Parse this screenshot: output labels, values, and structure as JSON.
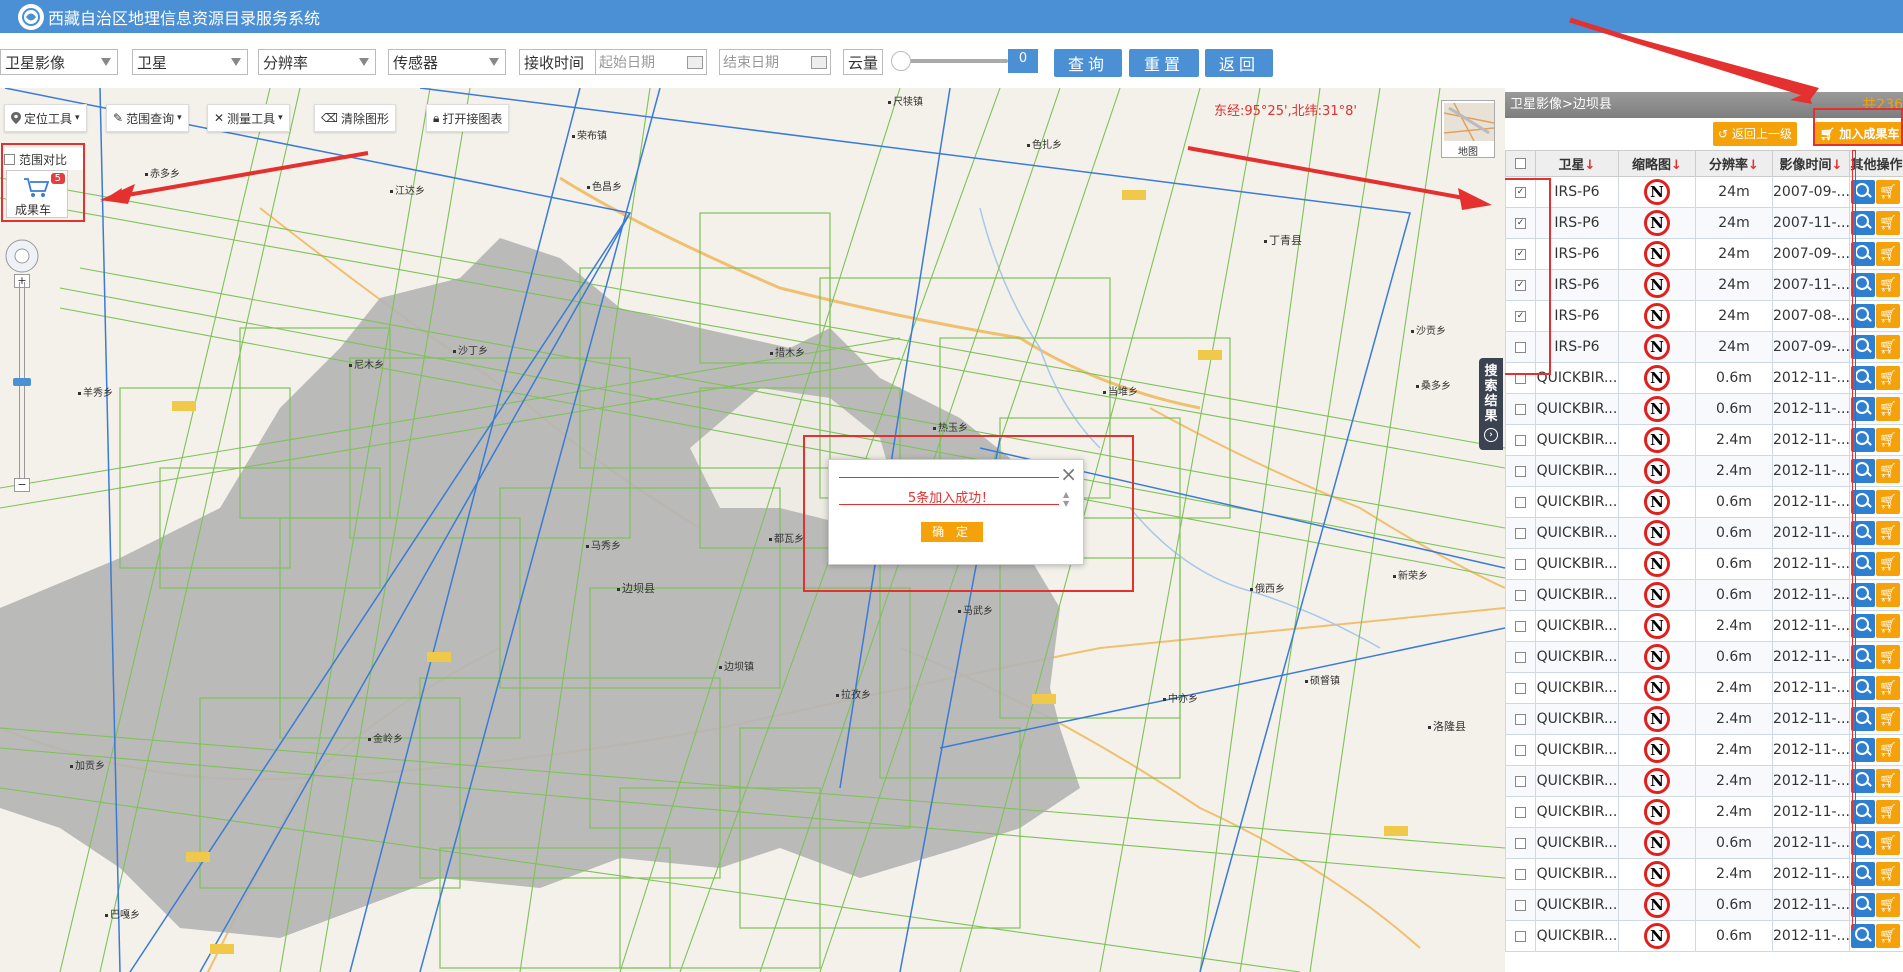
{
  "header": {
    "title": "西藏自治区地理信息资源目录服务系统"
  },
  "filters": {
    "category": "卫星影像",
    "platform": "卫星",
    "resolution": "分辨率",
    "sensor": "传感器",
    "receive_time_label": "接收时间",
    "start_date_placeholder": "起始日期",
    "end_date_placeholder": "结束日期",
    "cloud_label": "云量",
    "cloud_value": "0",
    "query_label": "查询",
    "reset_label": "重置",
    "back_label": "返回"
  },
  "map": {
    "coordinates": "东经:95°25',北纬:31°8'",
    "tools": {
      "locate": "定位工具",
      "range_query": "范围查询",
      "measure": "测量工具",
      "clear": "清除图形",
      "open_table": "打开接图表"
    },
    "compare_label": "范围对比",
    "cart_label": "成果车",
    "cart_count": "5",
    "map_type_label": "地图",
    "places": [
      {
        "name": "尺犊镇"
      },
      {
        "name": "荣布镇"
      },
      {
        "name": "赤多乡"
      },
      {
        "name": "江达乡"
      },
      {
        "name": "色昌乡"
      },
      {
        "name": "色扎乡"
      },
      {
        "name": "丁青县"
      },
      {
        "name": "尼木乡"
      },
      {
        "name": "沙丁乡"
      },
      {
        "name": "措木乡"
      },
      {
        "name": "沙贡乡"
      },
      {
        "name": "桑多乡"
      },
      {
        "name": "羊秀乡"
      },
      {
        "name": "当堆乡"
      },
      {
        "name": "热玉乡"
      },
      {
        "name": "马秀乡"
      },
      {
        "name": "都瓦乡"
      },
      {
        "name": "边坝县"
      },
      {
        "name": "马武乡"
      },
      {
        "name": "俄西乡"
      },
      {
        "name": "新荣乡"
      },
      {
        "name": "边坝镇"
      },
      {
        "name": "拉孜乡"
      },
      {
        "name": "中亦乡"
      },
      {
        "name": "硕督镇"
      },
      {
        "name": "洛隆县"
      },
      {
        "name": "金岭乡"
      },
      {
        "name": "加贡乡"
      },
      {
        "name": "巴嘎乡"
      }
    ]
  },
  "dialog": {
    "message": "5条加入成功！",
    "ok_label": "确 定"
  },
  "side_tab": {
    "label": "搜索结果"
  },
  "panel": {
    "breadcrumb": "卫星影像>边坝县",
    "count": "共236",
    "back_level_label": "返回上一级",
    "add_cart_label": "加入成果车",
    "columns": [
      "卫星",
      "缩略图",
      "分辨率",
      "影像时间",
      "其他操作"
    ],
    "rows": [
      {
        "checked": true,
        "satellite": "IRS-P6",
        "resolution": "24m",
        "time": "2007-09-..."
      },
      {
        "checked": true,
        "satellite": "IRS-P6",
        "resolution": "24m",
        "time": "2007-11-..."
      },
      {
        "checked": true,
        "satellite": "IRS-P6",
        "resolution": "24m",
        "time": "2007-09-..."
      },
      {
        "checked": true,
        "satellite": "IRS-P6",
        "resolution": "24m",
        "time": "2007-11-..."
      },
      {
        "checked": true,
        "satellite": "IRS-P6",
        "resolution": "24m",
        "time": "2007-08-..."
      },
      {
        "checked": false,
        "satellite": "IRS-P6",
        "resolution": "24m",
        "time": "2007-09-..."
      },
      {
        "checked": false,
        "satellite": "QUICKBIR...",
        "resolution": "0.6m",
        "time": "2012-11-..."
      },
      {
        "checked": false,
        "satellite": "QUICKBIR...",
        "resolution": "0.6m",
        "time": "2012-11-..."
      },
      {
        "checked": false,
        "satellite": "QUICKBIR...",
        "resolution": "2.4m",
        "time": "2012-11-..."
      },
      {
        "checked": false,
        "satellite": "QUICKBIR...",
        "resolution": "2.4m",
        "time": "2012-11-..."
      },
      {
        "checked": false,
        "satellite": "QUICKBIR...",
        "resolution": "0.6m",
        "time": "2012-11-..."
      },
      {
        "checked": false,
        "satellite": "QUICKBIR...",
        "resolution": "0.6m",
        "time": "2012-11-..."
      },
      {
        "checked": false,
        "satellite": "QUICKBIR...",
        "resolution": "0.6m",
        "time": "2012-11-..."
      },
      {
        "checked": false,
        "satellite": "QUICKBIR...",
        "resolution": "0.6m",
        "time": "2012-11-..."
      },
      {
        "checked": false,
        "satellite": "QUICKBIR...",
        "resolution": "2.4m",
        "time": "2012-11-..."
      },
      {
        "checked": false,
        "satellite": "QUICKBIR...",
        "resolution": "0.6m",
        "time": "2012-11-..."
      },
      {
        "checked": false,
        "satellite": "QUICKBIR...",
        "resolution": "2.4m",
        "time": "2012-11-..."
      },
      {
        "checked": false,
        "satellite": "QUICKBIR...",
        "resolution": "2.4m",
        "time": "2012-11-..."
      },
      {
        "checked": false,
        "satellite": "QUICKBIR...",
        "resolution": "2.4m",
        "time": "2012-11-..."
      },
      {
        "checked": false,
        "satellite": "QUICKBIR...",
        "resolution": "2.4m",
        "time": "2012-11-..."
      },
      {
        "checked": false,
        "satellite": "QUICKBIR...",
        "resolution": "2.4m",
        "time": "2012-11-..."
      },
      {
        "checked": false,
        "satellite": "QUICKBIR...",
        "resolution": "0.6m",
        "time": "2012-11-..."
      },
      {
        "checked": false,
        "satellite": "QUICKBIR...",
        "resolution": "2.4m",
        "time": "2012-11-..."
      },
      {
        "checked": false,
        "satellite": "QUICKBIR...",
        "resolution": "0.6m",
        "time": "2012-11-..."
      },
      {
        "checked": false,
        "satellite": "QUICKBIR...",
        "resolution": "0.6m",
        "time": "2012-11-..."
      }
    ],
    "thumb_icon": "north-n-icon",
    "op_icons": [
      "magnifier-icon",
      "cart-icon"
    ]
  },
  "colors": {
    "header_blue": "#4b90d4",
    "accent_orange": "#f5a20a",
    "highlight_red": "#e53030",
    "footprint_green": "#7fc15a",
    "footprint_blue": "#3a7bd5",
    "region_gray": "#b4b4b4"
  }
}
